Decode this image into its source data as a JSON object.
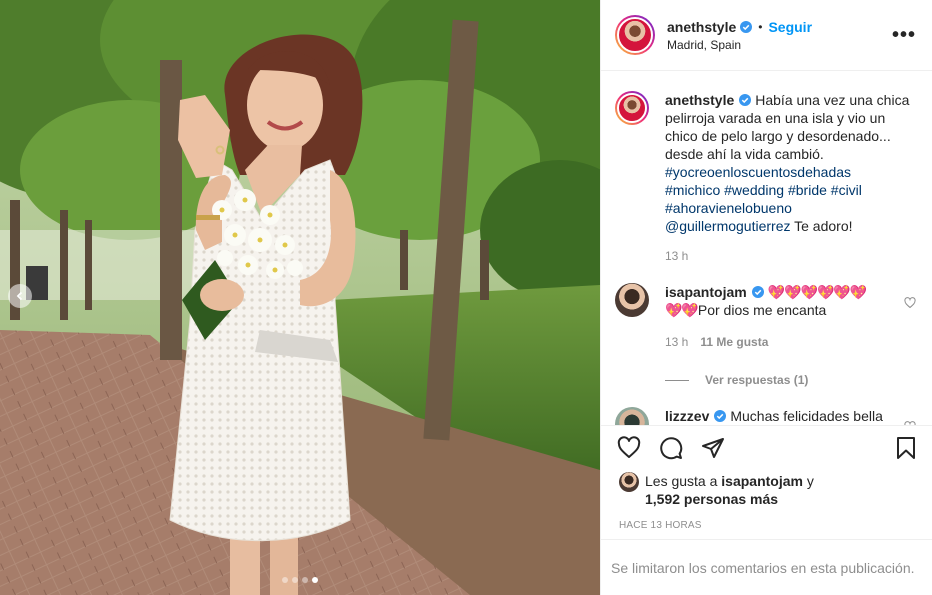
{
  "post_author": {
    "username": "anethstyle",
    "follow_label": "Seguir",
    "separator": "•",
    "location": "Madrid, Spain",
    "more_label": "•••"
  },
  "caption": {
    "username": "anethstyle",
    "text": "Había una vez una chica pelirroja varada en una isla y vio un chico de pelo largo y desordenado... desde ahí la vida cambió.",
    "hashtags": [
      "#yocreoenloscuentosdehadas",
      "#michico",
      "#wedding",
      "#bride",
      "#civil",
      "#ahoravienelobueno"
    ],
    "mention": "@guillermogutierrez",
    "after_mention": " Te adoro!",
    "time": "13 h"
  },
  "comments": [
    {
      "username": "isapantojam",
      "hearts": "💖💖💖💖💖💖",
      "hearts_line2": "💖💖",
      "text": "Por dios me encanta",
      "time": "13 h",
      "likes": "11 Me gusta",
      "replies": "Ver respuestas (1)"
    },
    {
      "username": "lizzzev",
      "text": "Muchas felicidades bella"
    }
  ],
  "likes": {
    "prefix": "Les gusta a ",
    "liker": "isapantojam",
    "middle": " y",
    "count": "1,592 personas más"
  },
  "time_ago": "HACE 13 HORAS",
  "comments_closed": "Se limitaron los comentarios en esta publicación.",
  "carousel": {
    "total": 4,
    "active_index": 3
  },
  "colors": {
    "accent": "#0095f6",
    "hashtag": "#00376b",
    "muted": "#8e8e8e"
  }
}
